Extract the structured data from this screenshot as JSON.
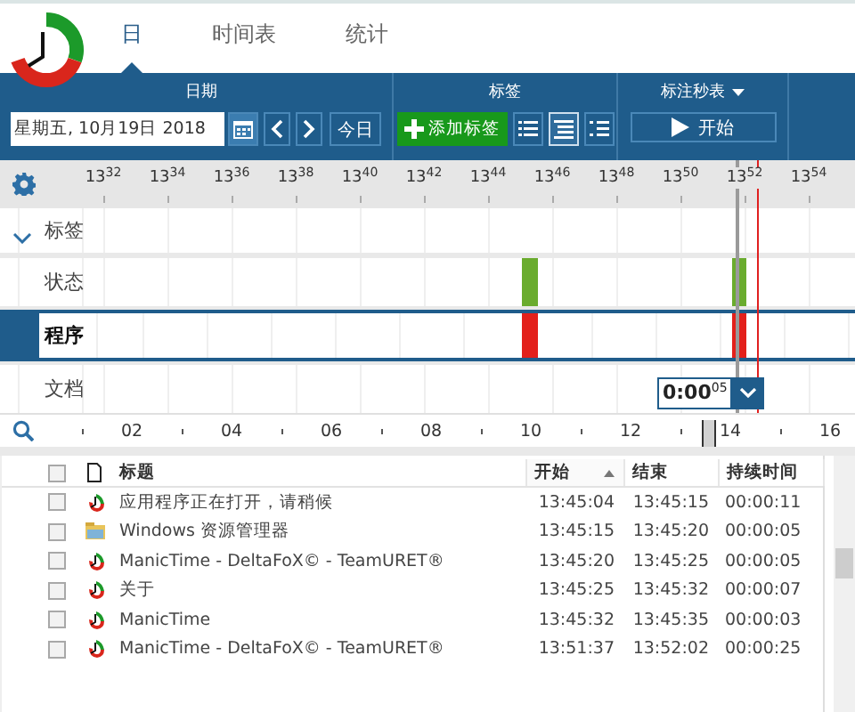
{
  "tabs": [
    {
      "label": "日",
      "selected": true
    },
    {
      "label": "时间表",
      "selected": false
    },
    {
      "label": "统计",
      "selected": false
    }
  ],
  "ribbon": {
    "date_group": {
      "title": "日期",
      "date": "星期五, 10月19日 2018",
      "today": "今日"
    },
    "tags_group": {
      "title": "标签",
      "add": "添加标签",
      "views": [
        {
          "selected": false
        },
        {
          "selected": true
        },
        {
          "selected": false
        }
      ]
    },
    "stopwatch_group": {
      "title": "标注秒表",
      "start": "开始"
    }
  },
  "timeline": {
    "ticks": [
      "13$^{32}$",
      "13$^{34}$",
      "13$^{36}$",
      "13$^{38}$",
      "13$^{40}$",
      "13$^{42}$",
      "13$^{44}$",
      "13$^{46}$",
      "13$^{48}$",
      "13$^{50}$",
      "13$^{52}$",
      "13$^{54}$"
    ],
    "rows": [
      {
        "label": "标签",
        "kind": "tags",
        "selected": false
      },
      {
        "label": "状态",
        "kind": "status",
        "selected": false
      },
      {
        "label": "程序",
        "kind": "program",
        "selected": true
      },
      {
        "label": "文档",
        "kind": "document",
        "selected": false
      }
    ],
    "timer": "0:00$^{05}$",
    "overview_labels": [
      "02",
      "04",
      "06",
      "08",
      "10",
      "12",
      "14",
      "16"
    ]
  },
  "table": {
    "all_checked": false,
    "columns": [
      {
        "label": "标题",
        "sorted": false
      },
      {
        "label": "开始",
        "sorted": true
      },
      {
        "label": "结束",
        "sorted": false
      },
      {
        "label": "持续时间",
        "sorted": false
      }
    ],
    "rows": [
      {
        "checked": false,
        "kind": "app",
        "title": "应用程序正在打开，请稍候",
        "start": "13:45:04",
        "end": "13:45:15",
        "duration": "00:00:11"
      },
      {
        "checked": false,
        "kind": "explorer",
        "title": "Windows 资源管理器",
        "start": "13:45:15",
        "end": "13:45:20",
        "duration": "00:00:05"
      },
      {
        "checked": false,
        "kind": "app",
        "title": "ManicTime - DeltaFoX© - TeamURET®",
        "start": "13:45:20",
        "end": "13:45:25",
        "duration": "00:00:05"
      },
      {
        "checked": false,
        "kind": "app",
        "title": "关于",
        "start": "13:45:25",
        "end": "13:45:32",
        "duration": "00:00:07"
      },
      {
        "checked": false,
        "kind": "app",
        "title": "ManicTime",
        "start": "13:45:32",
        "end": "13:45:35",
        "duration": "00:00:03"
      },
      {
        "checked": false,
        "kind": "app",
        "title": "ManicTime - DeltaFoX© - TeamURET®",
        "start": "13:51:37",
        "end": "13:52:02",
        "duration": "00:00:25"
      }
    ]
  }
}
